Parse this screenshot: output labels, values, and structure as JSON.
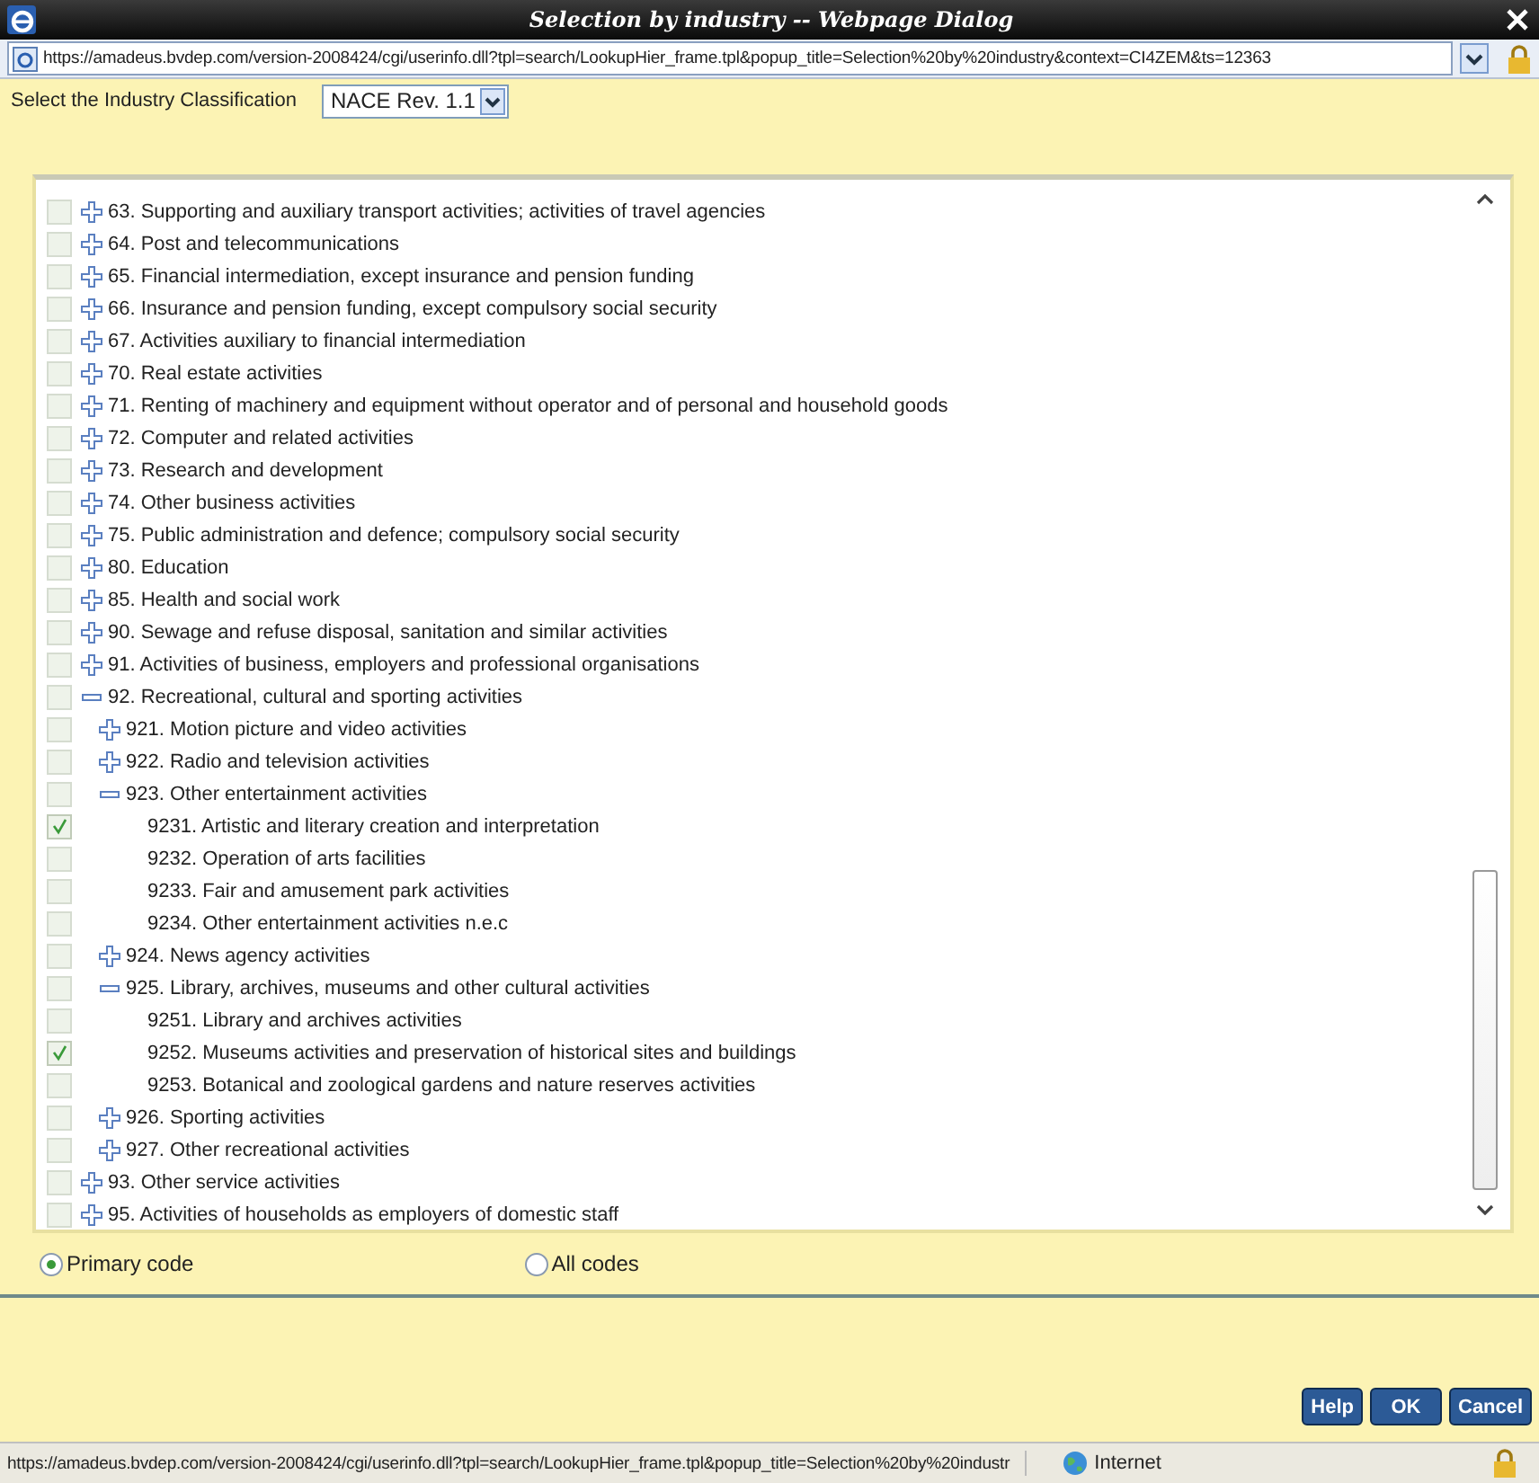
{
  "window": {
    "title": "Selection by industry -- Webpage Dialog"
  },
  "address_bar": {
    "url": "https://amadeus.bvdep.com/version-2008424/cgi/userinfo.dll?tpl=search/LookupHier_frame.tpl&popup_title=Selection%20by%20industry&context=CI4ZEM&ts=12363"
  },
  "classification": {
    "label": "Select the Industry Classification",
    "value": "NACE Rev. 1.1"
  },
  "tree": {
    "items": [
      {
        "kind": "branch",
        "label": "63. Supporting and auxiliary transport activities; activities of travel agencies",
        "checked": false,
        "expanded": false
      },
      {
        "kind": "branch",
        "label": "64. Post and telecommunications",
        "checked": false,
        "expanded": false
      },
      {
        "kind": "branch",
        "label": "65. Financial intermediation, except insurance and pension funding",
        "checked": false,
        "expanded": false
      },
      {
        "kind": "branch",
        "label": "66. Insurance and pension funding, except compulsory social security",
        "checked": false,
        "expanded": false
      },
      {
        "kind": "branch",
        "label": "67. Activities auxiliary to financial intermediation",
        "checked": false,
        "expanded": false
      },
      {
        "kind": "branch",
        "label": "70. Real estate activities",
        "checked": false,
        "expanded": false
      },
      {
        "kind": "branch",
        "label": "71. Renting of machinery and equipment without operator and of personal and household goods",
        "checked": false,
        "expanded": false
      },
      {
        "kind": "branch",
        "label": "72. Computer and related activities",
        "checked": false,
        "expanded": false
      },
      {
        "kind": "branch",
        "label": "73. Research and development",
        "checked": false,
        "expanded": false
      },
      {
        "kind": "branch",
        "label": "74. Other business activities",
        "checked": false,
        "expanded": false
      },
      {
        "kind": "branch",
        "label": "75. Public administration and defence; compulsory social security",
        "checked": false,
        "expanded": false
      },
      {
        "kind": "branch",
        "label": "80. Education",
        "checked": false,
        "expanded": false
      },
      {
        "kind": "branch",
        "label": "85. Health and social work",
        "checked": false,
        "expanded": false
      },
      {
        "kind": "branch",
        "label": "90. Sewage and refuse disposal, sanitation and similar activities",
        "checked": false,
        "expanded": false
      },
      {
        "kind": "branch",
        "label": "91. Activities of business, employers and professional organisations",
        "checked": false,
        "expanded": false
      },
      {
        "kind": "branch",
        "label": "92. Recreational, cultural and sporting activities",
        "checked": false,
        "expanded": true,
        "children": [
          {
            "kind": "branch",
            "label": "921. Motion picture and video activities",
            "checked": false,
            "expanded": false
          },
          {
            "kind": "branch",
            "label": "922. Radio and television activities",
            "checked": false,
            "expanded": false
          },
          {
            "kind": "branch",
            "label": "923. Other entertainment activities",
            "checked": false,
            "expanded": true,
            "children": [
              {
                "kind": "leaf",
                "label": "9231. Artistic and literary creation and interpretation",
                "checked": true
              },
              {
                "kind": "leaf",
                "label": "9232. Operation of arts facilities",
                "checked": false
              },
              {
                "kind": "leaf",
                "label": "9233. Fair and amusement park activities",
                "checked": false
              },
              {
                "kind": "leaf",
                "label": "9234. Other entertainment activities n.e.c",
                "checked": false
              }
            ]
          },
          {
            "kind": "branch",
            "label": "924. News agency activities",
            "checked": false,
            "expanded": false
          },
          {
            "kind": "branch",
            "label": "925. Library, archives, museums and other cultural activities",
            "checked": false,
            "expanded": true,
            "children": [
              {
                "kind": "leaf",
                "label": "9251. Library and archives activities",
                "checked": false
              },
              {
                "kind": "leaf",
                "label": "9252. Museums activities and preservation of historical sites and buildings",
                "checked": true
              },
              {
                "kind": "leaf",
                "label": "9253. Botanical and zoological gardens and nature reserves activities",
                "checked": false
              }
            ]
          },
          {
            "kind": "branch",
            "label": "926. Sporting activities",
            "checked": false,
            "expanded": false
          },
          {
            "kind": "branch",
            "label": "927. Other recreational activities",
            "checked": false,
            "expanded": false
          }
        ]
      },
      {
        "kind": "branch",
        "label": "93. Other service activities",
        "checked": false,
        "expanded": false
      },
      {
        "kind": "branch",
        "label": "95. Activities of households as employers of domestic staff",
        "checked": false,
        "expanded": false
      }
    ]
  },
  "code_options": [
    {
      "label": "Primary code",
      "selected": true
    },
    {
      "label": "All codes",
      "selected": false
    }
  ],
  "buttons": [
    "Help",
    "OK",
    "Cancel"
  ],
  "status_bar": {
    "url": "https://amadeus.bvdep.com/version-2008424/cgi/userinfo.dll?tpl=search/LookupHier_frame.tpl&popup_title=Selection%20by%20industr",
    "zone": "Internet"
  }
}
